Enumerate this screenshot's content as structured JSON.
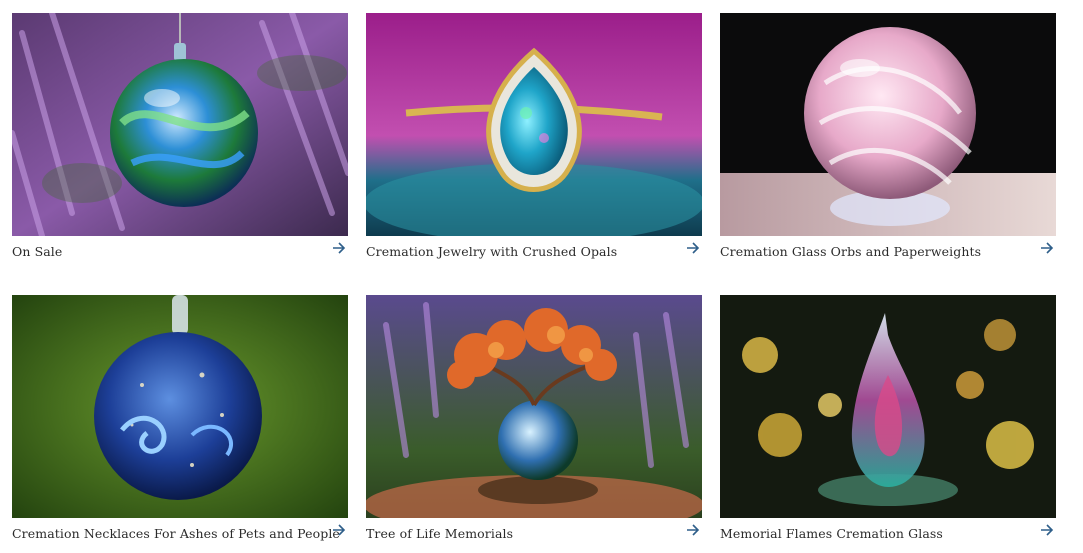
{
  "categories": [
    {
      "label": "On Sale",
      "image": "blue-green glass pendant over lavender",
      "icon": "arrow-right-icon"
    },
    {
      "label": "Cremation Jewelry with Crushed Opals",
      "image": "opal teardrop ring",
      "icon": "arrow-right-icon"
    },
    {
      "label": "Cremation Glass Orbs and Paperweights",
      "image": "pink swirl glass orb",
      "icon": "arrow-right-icon"
    },
    {
      "label": "Cremation Necklaces For Ashes of Pets and People",
      "image": "starry blue glass pendant",
      "icon": "arrow-right-icon"
    },
    {
      "label": "Tree of Life Memorials",
      "image": "orange tree on glass globe",
      "icon": "arrow-right-icon"
    },
    {
      "label": "Memorial Flames Cremation Glass",
      "image": "glowing glass flame",
      "icon": "arrow-right-icon"
    }
  ],
  "colors": {
    "caption_text": "#2b2b2b",
    "arrow": "#2f5f8a",
    "background": "#ffffff"
  }
}
